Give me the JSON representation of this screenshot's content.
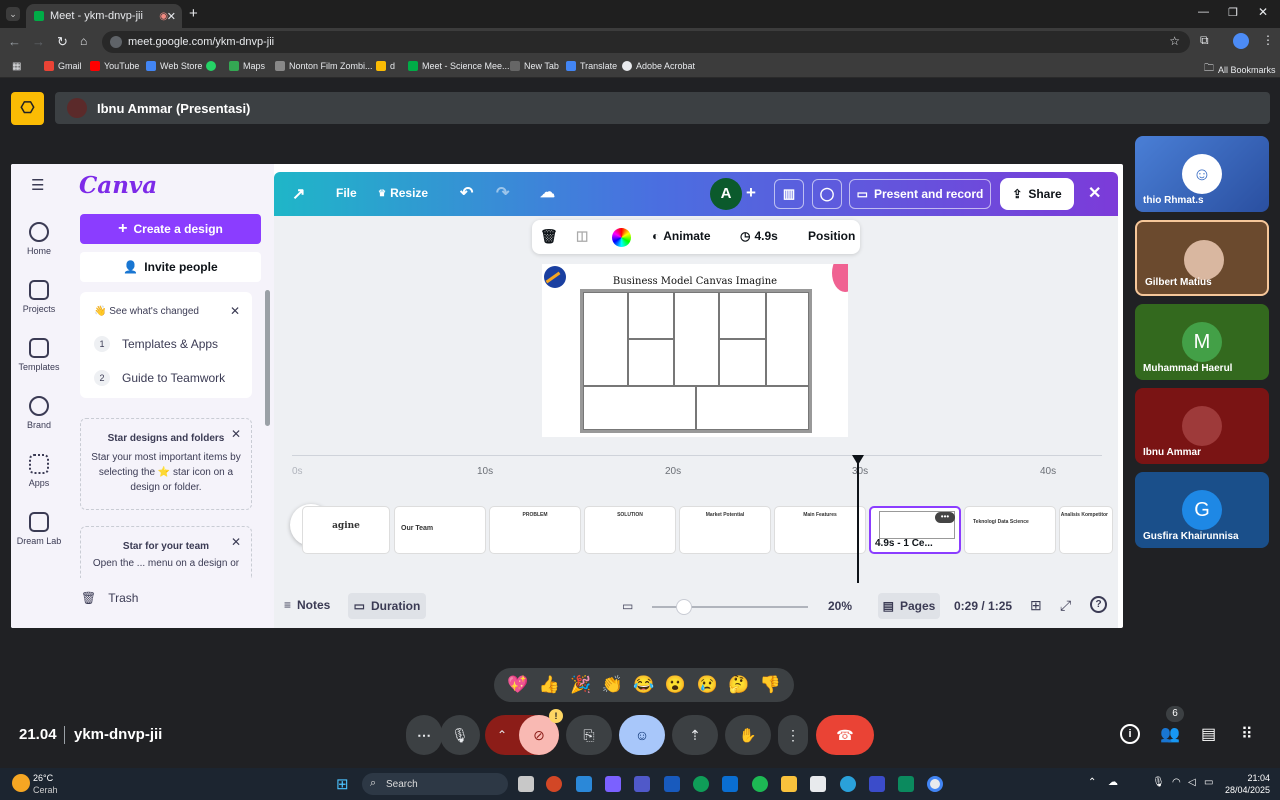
{
  "browser": {
    "tab_title": "Meet - ykm-dnvp-jii",
    "url": "meet.google.com/ykm-dnvp-jii",
    "bookmarks": [
      "Gmail",
      "YouTube",
      "Web Store",
      "Maps",
      "Nonton Film Zombi...",
      "d",
      "Meet - Science Mee...",
      "New Tab",
      "Translate",
      "Adobe Acrobat"
    ],
    "all_bookmarks": "All Bookmarks"
  },
  "meet": {
    "presenter_label": "Ibnu Ammar (Presentasi)",
    "time": "21.04",
    "meeting_code": "ykm-dnvp-jii",
    "people_count": "6",
    "participants": [
      {
        "name": "thio Rhmat.s",
        "bg": "#3b6fc6"
      },
      {
        "name": "Gilbert Matius",
        "bg": "#6b4a2e"
      },
      {
        "name": "Muhammad Haerul",
        "bg": "#2e7d32",
        "initial": "M"
      },
      {
        "name": "Ibnu Ammar",
        "bg": "#8b1a1a"
      },
      {
        "name": "Gusfira Khairunnisa",
        "bg": "#1a5fa8",
        "initial": "G"
      }
    ],
    "reactions": [
      "💖",
      "👍",
      "🎉",
      "👏",
      "😂",
      "😮",
      "😢",
      "🤔",
      "👎"
    ]
  },
  "canva": {
    "logo": "Canva",
    "create_design": "Create a design",
    "invite_people": "Invite people",
    "see_changed": "See what's changed",
    "list": [
      {
        "num": "1",
        "label": "Templates & Apps"
      },
      {
        "num": "2",
        "label": "Guide to Teamwork"
      }
    ],
    "star_title": "Star designs and folders",
    "star_body": "Star your most important items by selecting the ⭐ star icon on a design or folder.",
    "star_team_title": "Star for your team",
    "star_team_body": "Open the ... menu on a design or",
    "trash": "Trash",
    "nav": [
      "Home",
      "Projects",
      "Templates",
      "Brand",
      "Apps",
      "Dream Lab"
    ],
    "topbar": {
      "file": "File",
      "resize": "Resize",
      "avatar": "A",
      "present": "Present and record",
      "share": "Share"
    },
    "toolbar": {
      "animate": "Animate",
      "duration": "4.9s",
      "position": "Position"
    },
    "slide_title": "Business Model Canvas Imagine",
    "timeline_marks": [
      "0s",
      "10s",
      "20s",
      "30s",
      "40s"
    ],
    "pages": [
      {
        "title": "agine"
      },
      {
        "title": "Our Team"
      },
      {
        "title": "PROBLEM"
      },
      {
        "title": "SOLUTION"
      },
      {
        "title": "Market Potential"
      },
      {
        "title": "Main Features"
      },
      {
        "title": "4.9s - 1 Ce..."
      },
      {
        "title": "Teknologi Data Science"
      },
      {
        "title": "Analisis Kompetitor"
      }
    ],
    "bottom": {
      "notes": "Notes",
      "duration": "Duration",
      "zoom": "20%",
      "pages": "Pages",
      "time": "0:29 / 1:25"
    }
  },
  "taskbar": {
    "weather_temp": "26°C",
    "weather_text": "Cerah",
    "search": "Search",
    "clock_time": "21:04",
    "clock_date": "28/04/2025"
  }
}
